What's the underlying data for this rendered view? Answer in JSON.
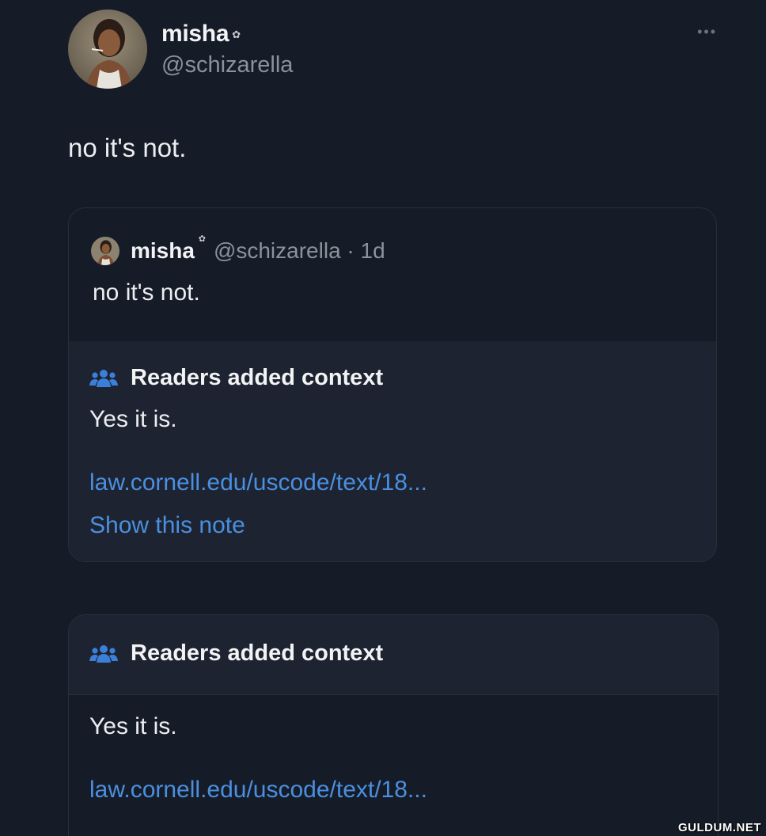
{
  "author": {
    "name": "misha",
    "badge_icon": "flower-badge-icon",
    "handle": "@schizarella"
  },
  "post": {
    "text": "no it's not.",
    "more_icon": "more-options-icon"
  },
  "quote": {
    "name": "misha",
    "handle_time": "@schizarella · 1d",
    "text": "no it's not.",
    "note": {
      "icon": "people-icon",
      "title": "Readers added context",
      "text": "Yes it is.",
      "link": "law.cornell.edu/uscode/text/18...",
      "action": "Show this note"
    }
  },
  "note_card": {
    "icon": "people-icon",
    "title": "Readers added context",
    "text": "Yes it is.",
    "link": "law.cornell.edu/uscode/text/18..."
  },
  "watermark": "GULDUM.NET",
  "colors": {
    "background": "#161c27",
    "card_fill": "#1d2330",
    "link": "#4a8fe0",
    "note_icon": "#3c7fd8"
  }
}
